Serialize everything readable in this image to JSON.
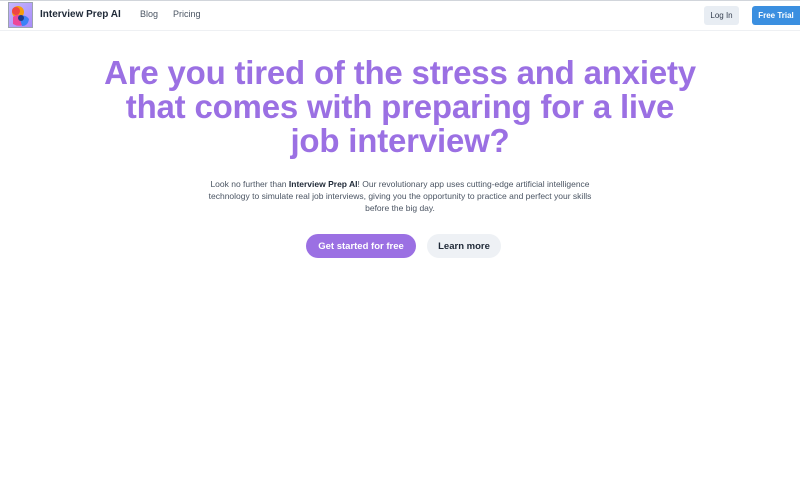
{
  "header": {
    "brand": "Interview Prep AI",
    "nav": [
      {
        "label": "Blog"
      },
      {
        "label": "Pricing"
      }
    ],
    "login_label": "Log In",
    "trial_label": "Free Trial"
  },
  "hero": {
    "title": "Are you tired of the stress and anxiety that comes with preparing for a live job interview?",
    "desc_prefix": "Look no further than ",
    "desc_brand": "Interview Prep AI",
    "desc_suffix": "! Our revolutionary app uses cutting-edge artificial intelligence technology to simulate real job interviews, giving you the opportunity to practice and perfect your skills before the big day.",
    "primary_cta": "Get started for free",
    "secondary_cta": "Learn more"
  },
  "colors": {
    "accent": "#9b70e3",
    "trial_button": "#3b8fe0",
    "login_button": "#e8edf3"
  },
  "icons": {
    "logo": "abstract-person-logo-icon"
  }
}
